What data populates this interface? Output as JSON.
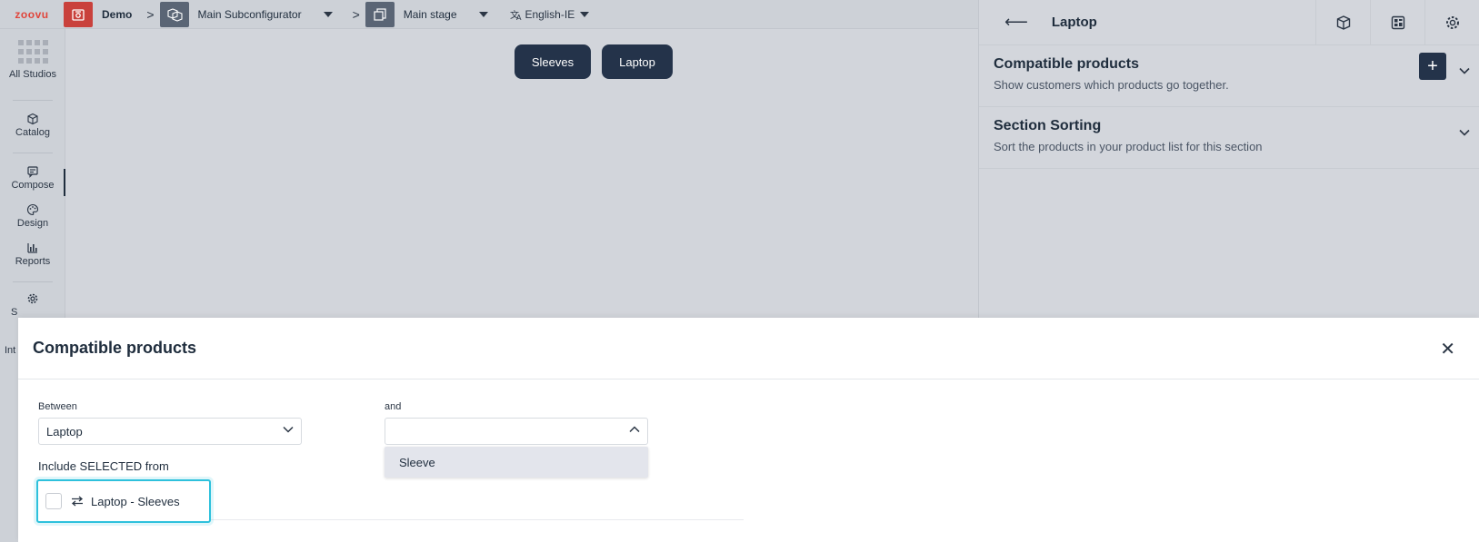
{
  "topbar": {
    "logo": "zoovu",
    "breadcrumbs": [
      "Demo",
      "Main Subconfigurator",
      "Main stage"
    ],
    "language": "English-IE"
  },
  "leftnav": {
    "items": [
      {
        "label": "All Studios"
      },
      {
        "label": "Catalog"
      },
      {
        "label": "Compose"
      },
      {
        "label": "Design"
      },
      {
        "label": "Reports"
      },
      {
        "label": "S"
      },
      {
        "label": "Int"
      }
    ],
    "active": "Compose"
  },
  "canvas": {
    "buttons": [
      "Sleeves",
      "Laptop"
    ]
  },
  "rightpanel": {
    "title": "Laptop",
    "sections": [
      {
        "title": "Compatible products",
        "description": "Show customers which products go together."
      },
      {
        "title": "Section Sorting",
        "description": "Sort the products in your product list for this section"
      }
    ]
  },
  "modal": {
    "title": "Compatible products",
    "between_label": "Between",
    "between_value": "Laptop",
    "and_label": "and",
    "and_value": "",
    "dropdown_option": "Sleeve",
    "include_label": "Include SELECTED from",
    "item_label": "Laptop - Sleeves"
  },
  "colors": {
    "brand": "#e0453b",
    "primary": "#24334a",
    "focus": "#2ec1dc"
  }
}
